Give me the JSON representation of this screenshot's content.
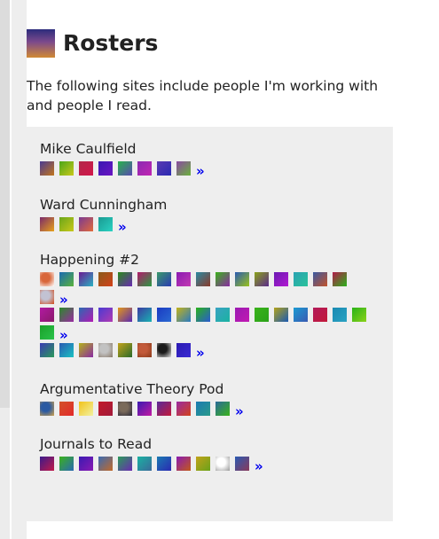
{
  "page": {
    "title": "Rosters",
    "intro": "The following sites include people I'm working with and people I read."
  },
  "more_symbol": "»",
  "rosters": [
    {
      "name": "Mike Caulfield",
      "rows": [
        [
          "#4a3a92|#c2761c",
          "#4aa61a|#c9c81a",
          "#b2284a|#d2164a",
          "#3a18b2|#6a16c2",
          "#26b24a|#5a4ab2",
          "#8a2ab2|#c226b2",
          "#5a3ab2|#2a2ab2",
          "#8a4aa2|#6ab23a"
        ]
      ],
      "more": [
        true
      ]
    },
    {
      "name": "Ward Cunningham",
      "rows": [
        [
          "#7a2a6a|#e8a21a",
          "#6aa61a|#c8c81a",
          "#7a3a92|#e26a3a",
          "#1a9a92|#2ad2c2"
        ]
      ],
      "more": [
        true
      ]
    },
    {
      "name": "Happening #2",
      "rows": [
        [
          "photo:#d8663a|#ffffff",
          "#1a6ab2|#5ab23a",
          "#6a1a92|#2ab2c2",
          "#8a5a1a|#d2421a",
          "#2a8a1a|#6a2ab2",
          "#b21a6a|#2a9a42",
          "#3a9a6a|#2a3ab2",
          "#8a1ab2|#c23ab2",
          "#2a8aa2|#8a3a2a",
          "#3ab21a|#8a2aa2",
          "#2a5ab2|#9ac21a",
          "#8aa21a|#5a2a8a",
          "#6a1ab2|#b21ad2",
          "#2aa2b2|#2ac29a",
          "#3a5aa2|#c2522a",
          "#b21a4a|#2ab21a"
        ],
        [
          "photo:#c2c2d2|#d24a1a"
        ],
        [
          "#b21aa2|#8a1a6a",
          "#2a8a2a|#9a2aa2",
          "#2a6ab2|#b21ab2",
          "#4a3ad2|#b23ab2",
          "#e2961a|#5a2ab2",
          "#3a3aa2|#1ab2b2",
          "#1a3ac2|#2a6ad2",
          "#c2b21a|#2a7ac2",
          "#2ab21a|#2a5ad2",
          "#3aa2c2|#1ab2a2",
          "#9a1ab2|#c21ab2",
          "#3ab21a|#2aa21a",
          "#b2a21a|#1a5ab2",
          "#1a9ad2|#3a5ab2",
          "#b21a5a|#c21a3a",
          "#1a8ab2|#2aa2c2",
          "#2ab21a|#8ad21a"
        ],
        [
          "#1aa22a|#2ac24a"
        ],
        [
          "#3a3ab2|#2a9a5a",
          "#2a5ab2|#1ac2c2",
          "#b2b21a|#8a2aa2",
          "photo:#c2c2c2|#8a7a6a",
          "#c2a21a|#2a6a2a",
          "photo:#c25a3a|#8a3a1a",
          "photo:#1a1a1a|#e2e2e2",
          "#2a1ab2|#3a2ad2"
        ]
      ],
      "more": [
        false,
        true,
        false,
        true,
        true
      ]
    },
    {
      "name": "Argumentative Theory Pod",
      "rows": [
        [
          "photo:#2a5aa2|#d2a24a",
          "#d2522a|#e22a2a",
          "#f2c21a|#f2f2a2",
          "#c21a2a|#a21a3a",
          "photo:#7a6a5a|#2a2a3a",
          "#3a1ab2|#c21aa2",
          "#5a2a9a|#c21a3a",
          "#9a2aa2|#d2421a",
          "#1a7ab2|#2a9a8a",
          "#2a6a9a|#3ab21a"
        ]
      ],
      "more": [
        true
      ]
    },
    {
      "name": "Journals to Read",
      "rows": [
        [
          "#3a1a8a|#c21a4a",
          "#3ab21a|#2a6ab2",
          "#3a1ab2|#8a1ab2",
          "#3a6ab2|#c26a2a",
          "#2a9a5a|#6a2ab2",
          "#1ab2a2|#3a6a9a",
          "#1a7ab2|#2a2ab2",
          "#8a1ab2|#c25a1a",
          "#c2a21a|#6aa21a",
          "photo:#ffffff|#999999",
          "#2a5ab2|#8a3a5a"
        ]
      ],
      "more": [
        true
      ]
    }
  ]
}
